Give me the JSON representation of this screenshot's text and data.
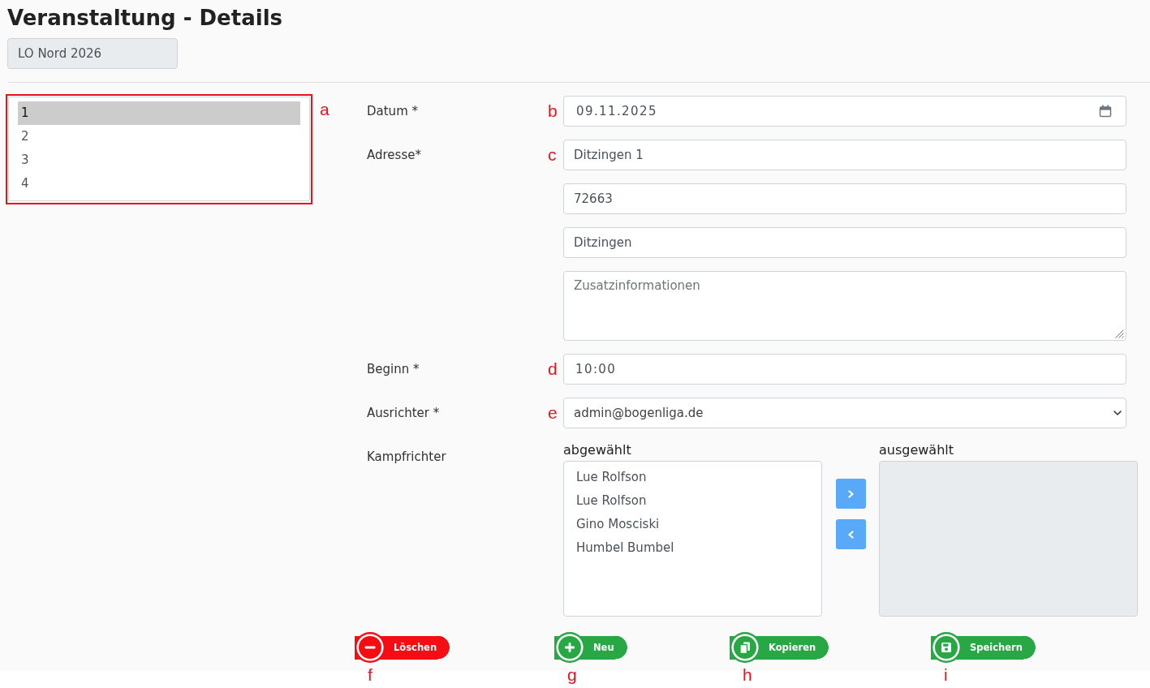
{
  "page": {
    "title": "Veranstaltung - Details",
    "season": {
      "value": "LO Nord 2026",
      "disabled": true
    }
  },
  "event_list": {
    "annotation": "a",
    "items": [
      {
        "label": "1",
        "selected": true
      },
      {
        "label": "2",
        "selected": false
      },
      {
        "label": "3",
        "selected": false
      },
      {
        "label": "4",
        "selected": false
      }
    ]
  },
  "form": {
    "fields": [
      {
        "kind": "date",
        "label": "Datum *",
        "annotation": "b",
        "value": "09.11.2025"
      },
      {
        "kind": "text",
        "label": "Adresse*",
        "annotation": "c",
        "value": "Ditzingen 1"
      },
      {
        "kind": "text",
        "value": "72663"
      },
      {
        "kind": "text",
        "value": "Ditzingen"
      },
      {
        "kind": "textarea",
        "placeholder": "Zusatzinformationen"
      },
      {
        "kind": "time",
        "label": "Beginn *",
        "annotation": "d",
        "value": "10:00"
      },
      {
        "kind": "select",
        "label": "Ausrichter *",
        "annotation": "e",
        "value": "admin@bogenliga.de"
      }
    ],
    "referees": {
      "label": "Kampfrichter",
      "available": {
        "title": "abgewählt",
        "items": [
          {
            "label": "Lue Rolfson",
            "selected": false
          },
          {
            "label": "Lue Rolfson",
            "selected": false
          },
          {
            "label": "Gino Mosciski",
            "selected": false
          },
          {
            "label": "Humbel Bumbel",
            "selected": false
          }
        ]
      },
      "chosen": {
        "title": "ausgewählt",
        "disabled": true
      }
    }
  },
  "actions": [
    {
      "kind": "delete",
      "label": "Löschen",
      "annotation": "f"
    },
    {
      "kind": "new",
      "label": "Neu",
      "annotation": "g"
    },
    {
      "kind": "copy",
      "label": "Kopieren",
      "annotation": "h"
    },
    {
      "kind": "save",
      "label": "Speichern",
      "annotation": "i"
    }
  ]
}
